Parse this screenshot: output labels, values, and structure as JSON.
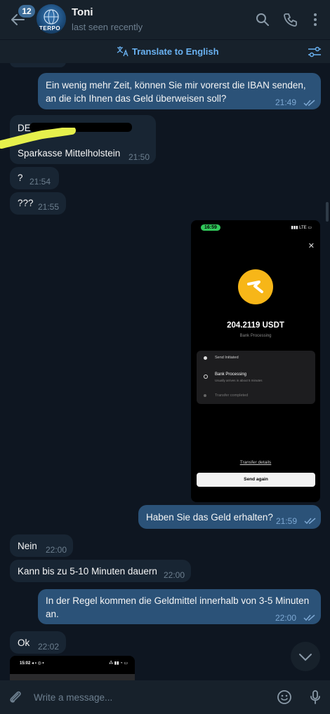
{
  "header": {
    "unread_count": "12",
    "contact_name": "Toni",
    "contact_status": "last seen recently",
    "avatar_text": "TERPO"
  },
  "translate_bar": {
    "label": "Translate to English"
  },
  "messages": [
    {
      "direction": "out",
      "text": "Ein wenig mehr Zeit, können Sie mir vorerst die IBAN senden, an die ich Ihnen das Geld überweisen soll?",
      "time": "21:49",
      "read": true
    },
    {
      "direction": "in",
      "line1": "DE",
      "line2": "Sparkasse Mittelholstein",
      "time": "21:50"
    },
    {
      "direction": "in",
      "text": "?",
      "time": "21:54"
    },
    {
      "direction": "in",
      "text": "???",
      "time": "21:55"
    },
    {
      "direction": "out",
      "type": "image",
      "read": true
    },
    {
      "direction": "out",
      "text": "Haben Sie das Geld erhalten?",
      "time": "21:59",
      "read": true
    },
    {
      "direction": "in",
      "text": "Nein",
      "time": "22:00"
    },
    {
      "direction": "in",
      "text": "Kann bis zu 5-10 Minuten dauern",
      "time": "22:00"
    },
    {
      "direction": "out",
      "text": "In der Regel kommen die Geldmittel innerhalb von 3-5 Minuten an.",
      "time": "22:00",
      "read": true
    },
    {
      "direction": "in",
      "text": "Ok",
      "time": "22:02"
    }
  ],
  "screenshot": {
    "status_time": "16:59",
    "status_right": "LTE",
    "amount": "204.2119 USDT",
    "amount_status": "Bank Processing",
    "steps": [
      {
        "label": "Send Initiated"
      },
      {
        "label": "Bank Processing",
        "sub": "Usually arrives in about 5 minutes"
      },
      {
        "label": "Transfer completed"
      }
    ],
    "transfer_details": "Transfer details",
    "send_again": "Send again"
  },
  "screenshot2": {
    "status_time": "15:02"
  },
  "compose": {
    "placeholder": "Write a message..."
  },
  "colors": {
    "background": "#0e1621",
    "header": "#17212b",
    "incoming_bubble": "#182533",
    "outgoing_bubble": "#2b5278",
    "accent": "#6ab2f2",
    "coin": "#f7b618"
  }
}
